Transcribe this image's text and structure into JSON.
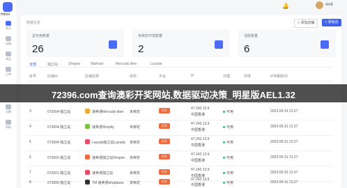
{
  "app": {
    "logo_text": "Hitoor"
  },
  "sidebar": {
    "items": [
      {
        "label": "首页"
      },
      {
        "label": "店铺"
      },
      {
        "label": "商品"
      },
      {
        "label": "订单"
      },
      {
        "label": "设置"
      },
      {
        "label": "帮助"
      }
    ]
  },
  "topbar": {
    "user_name": "vinit"
  },
  "header": {
    "section_title": "数据总览",
    "secondary_button": "□ 添加店铺",
    "primary_button": "□ 添加店铺"
  },
  "stats": [
    {
      "label": "总可用数量",
      "value": "26"
    },
    {
      "label": "未绑定环境数量",
      "value": "2"
    },
    {
      "label": "活跃数量",
      "value": "6"
    }
  ],
  "tabs": [
    "全部",
    "独立站",
    "Shopee",
    "Walmart",
    "Mercado libre",
    "Lazada"
  ],
  "table": {
    "headers": [
      "序号",
      "店铺ID",
      "店铺名称",
      "状态",
      "平台",
      "IP",
      "代理",
      "环境",
      "IP到期时间"
    ],
    "rows": [
      {
        "index": "3",
        "id": "073004-独立站",
        "name": "速卖通Mercado libre",
        "status": "未绑定",
        "pill": "打开",
        "ip": "47.242.13.9",
        "region": "中国香港",
        "proxy": "可用",
        "date": "2022-05-31 21:27"
      },
      {
        "index": "4",
        "id": "073004-独立站",
        "name": "速卖通Shopify",
        "status": "未绑定",
        "pill": "打开",
        "ip": "47.242.13.9",
        "region": "中国香港",
        "proxy": "可用",
        "date": "2022-05-31 21:27"
      },
      {
        "index": "5",
        "id": "073004-独立站",
        "name": "Lazada独立站Lazada",
        "status": "未绑定",
        "pill": "打开",
        "ip": "47.242.13.9",
        "region": "中国香港",
        "proxy": "可用",
        "date": "2022-05-31 21:27"
      },
      {
        "index": "6",
        "id": "073002-独立站",
        "name": "速卖通独立站Shopee",
        "status": "未绑定",
        "pill": "打开",
        "ip": "47.242.13.9",
        "region": "中国香港",
        "proxy": "可用",
        "date": "2022-05-31 21:27"
      },
      {
        "index": "7",
        "id": "073001-独立站",
        "name": "速卖通独立站",
        "status": "未绑定",
        "pill": "打开",
        "ip": "47.242.13.9",
        "region": "中国香港",
        "proxy": "可用",
        "date": "2022-05-31 21:27"
      },
      {
        "index": "8",
        "id": "073000-独立站",
        "name": "TM 速卖通shopbaza",
        "status": "未绑定",
        "pill": "打开",
        "ip": "47.242.13.9",
        "region": "中国香港",
        "proxy": "可用",
        "date": "2022-05-31 21:27"
      }
    ]
  },
  "banner": {
    "text": "72396.com查询澳彩开奖网站,数据驱动决策_明星版AEL1.32"
  },
  "colors": {
    "accent": "#3f63f0",
    "status_pill": "#f06a3c",
    "ok": "#36b37e"
  }
}
